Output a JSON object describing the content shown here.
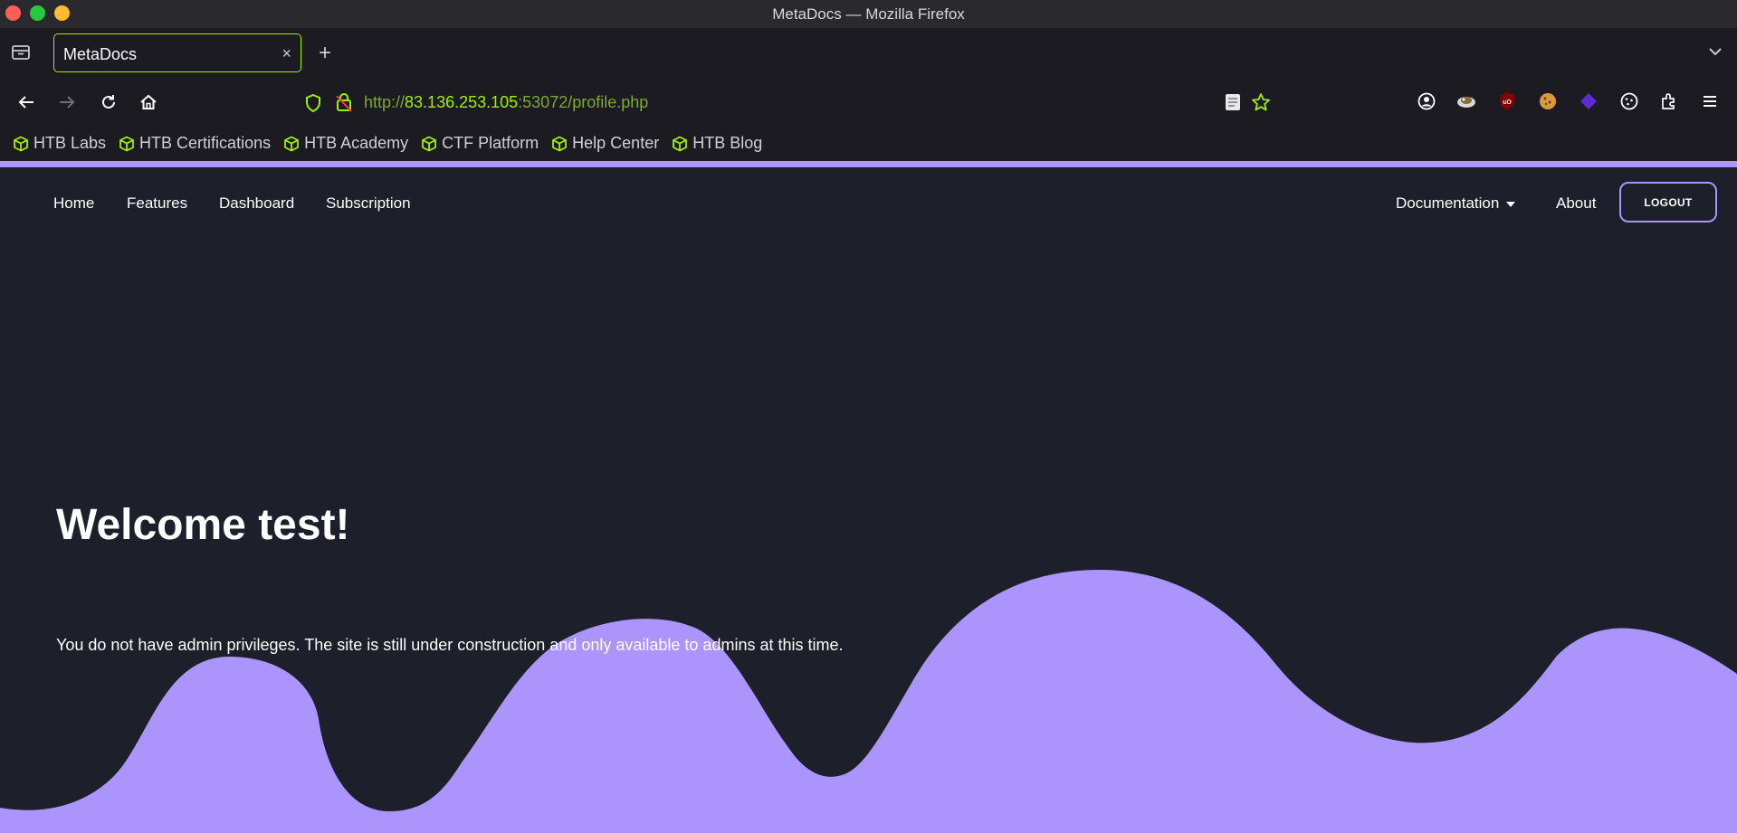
{
  "window": {
    "title": "MetaDocs — Mozilla Firefox"
  },
  "tab": {
    "title": "MetaDocs",
    "close": "×",
    "new_tab": "+"
  },
  "url": {
    "protocol": "http://",
    "host": "83.136.253.105",
    "rest": ":53072/profile.php"
  },
  "bookmarks": [
    {
      "label": "HTB Labs",
      "icon": "cube-icon"
    },
    {
      "label": "HTB Certifications",
      "icon": "cube-icon"
    },
    {
      "label": "HTB Academy",
      "icon": "cube-icon"
    },
    {
      "label": "CTF Platform",
      "icon": "cube-icon"
    },
    {
      "label": "Help Center",
      "icon": "cube-icon"
    },
    {
      "label": "HTB Blog",
      "icon": "cube-icon"
    }
  ],
  "site_nav": {
    "home": "Home",
    "features": "Features",
    "dashboard": "Dashboard",
    "subscription": "Subscription",
    "documentation": "Documentation",
    "about": "About",
    "logout": "LOGOUT"
  },
  "hero": {
    "heading": "Welcome test!",
    "message": "You do not have admin privileges. The site is still under construction and only available to admins at this time."
  },
  "colors": {
    "page_bg": "#1d1f2a",
    "accent": "#ab95fc",
    "htb_green": "#9fef00"
  }
}
